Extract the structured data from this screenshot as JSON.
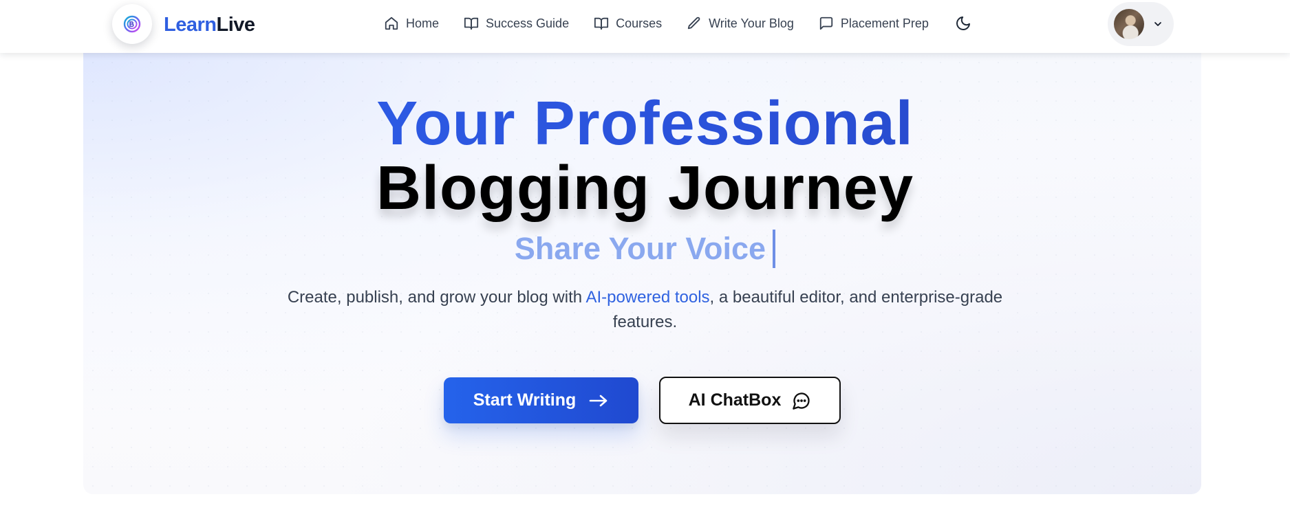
{
  "brand": {
    "name_part1": "Learn",
    "name_part2": "Live",
    "logo_icon": "brain-icon"
  },
  "nav": {
    "items": [
      {
        "label": "Home",
        "icon": "home-icon"
      },
      {
        "label": "Success Guide",
        "icon": "book-open-icon"
      },
      {
        "label": "Courses",
        "icon": "book-open-icon"
      },
      {
        "label": "Write Your Blog",
        "icon": "pencil-icon"
      },
      {
        "label": "Placement Prep",
        "icon": "message-square-icon"
      }
    ],
    "theme_toggle_icon": "moon-icon",
    "profile_icon": "chevron-down-icon"
  },
  "hero": {
    "title_line1": "Your Professional",
    "title_line2": "Blogging Journey",
    "subtitle": "Share Your Voice",
    "description_before": "Create, publish, and grow your blog with ",
    "description_highlight": "AI-powered tools",
    "description_after": ", a beautiful editor, and enterprise-grade features.",
    "primary_button": "Start Writing",
    "primary_button_icon": "arrow-right-icon",
    "secondary_button": "AI ChatBox",
    "secondary_button_icon": "chat-bubble-icon"
  },
  "colors": {
    "accent": "#2563eb",
    "title_blue": "#2a56dd",
    "subtitle_blue": "#8aa8ef",
    "text_dark": "#111827"
  }
}
